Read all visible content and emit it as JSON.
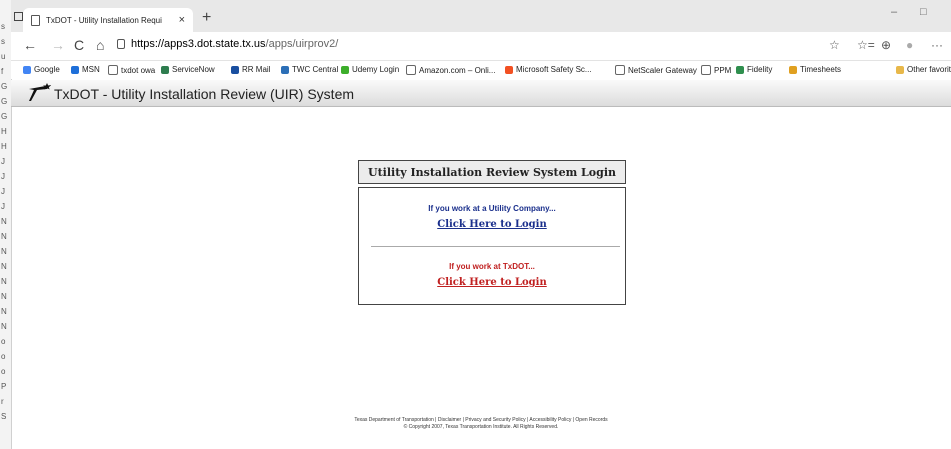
{
  "left_strip": {
    "letters": [
      "s",
      "s",
      "u",
      "f",
      "G",
      "G",
      "G",
      "H",
      "H",
      "J",
      "J",
      "J",
      "J",
      "N",
      "N",
      "N",
      "N",
      "N",
      "N",
      "N",
      "N",
      "o",
      "o",
      "o",
      "P",
      "r",
      "S"
    ]
  },
  "browser": {
    "tab_title": "TxDOT - Utility Installation Requi",
    "tab_close": "×",
    "new_tab": "+",
    "window_controls": {
      "minimize": "–",
      "maximize": "□",
      "close": "✕"
    },
    "nav": {
      "back": "←",
      "forward": "→",
      "refresh": "C",
      "home": "⌂"
    },
    "url_host": "https://apps3.dot.state.tx.us",
    "url_path": "/apps/uirprov2/",
    "toolbar_icons": {
      "favorites": "☆",
      "collections": "☆=",
      "extensions": "⊕",
      "profile": "●",
      "more": "···"
    },
    "bookmarks": [
      {
        "label": "Google",
        "icon": "google-icon",
        "color": "#4285f4"
      },
      {
        "label": "MSN",
        "icon": "msn-icon",
        "color": "#1e6fd9"
      },
      {
        "label": "txdot owa",
        "icon": "page-icon",
        "color": "#ffffff"
      },
      {
        "label": "ServiceNow",
        "icon": "servicenow-icon",
        "color": "#2e7d4f"
      },
      {
        "label": "RR Mail",
        "icon": "rrmail-icon",
        "color": "#1a4fa0"
      },
      {
        "label": "TWC Central",
        "icon": "twc-icon",
        "color": "#2c6fb7"
      },
      {
        "label": "Udemy Login",
        "icon": "udemy-icon",
        "color": "#3dae2b"
      },
      {
        "label": "Amazon.com – Onli...",
        "icon": "page-icon",
        "color": "#ffffff"
      },
      {
        "label": "Microsoft Safety Sc...",
        "icon": "microsoft-icon",
        "color": "#f25022"
      },
      {
        "label": "NetScaler Gateway",
        "icon": "page-icon",
        "color": "#ffffff"
      },
      {
        "label": "PPM",
        "icon": "page-icon",
        "color": "#ffffff"
      },
      {
        "label": "Fidelity",
        "icon": "fidelity-icon",
        "color": "#2f8f4e"
      },
      {
        "label": "Timesheets",
        "icon": "timesheets-icon",
        "color": "#e0a020"
      },
      {
        "label": "Other favorit",
        "icon": "folder-icon",
        "color": "#e8b84a"
      }
    ]
  },
  "app": {
    "title": "TxDOT - Utility Installation Review (UIR) System",
    "login_box": {
      "header": "Utility Installation Review System Login",
      "utility_prompt": "If you work at a Utility Company...",
      "utility_link": "Click Here to Login",
      "txdot_prompt": "If you work at TxDOT...",
      "txdot_link": "Click Here to Login"
    },
    "footer": {
      "line1": "Texas Department of Transportation | Disclaimer | Privacy and Security Policy | Accessibility Policy | Open Records",
      "line2": "© Copyright 2007, Texas Transportation Institute. All Rights Reserved."
    }
  },
  "colors": {
    "utility_blue": "#1a2f8c",
    "txdot_red": "#c02020"
  }
}
